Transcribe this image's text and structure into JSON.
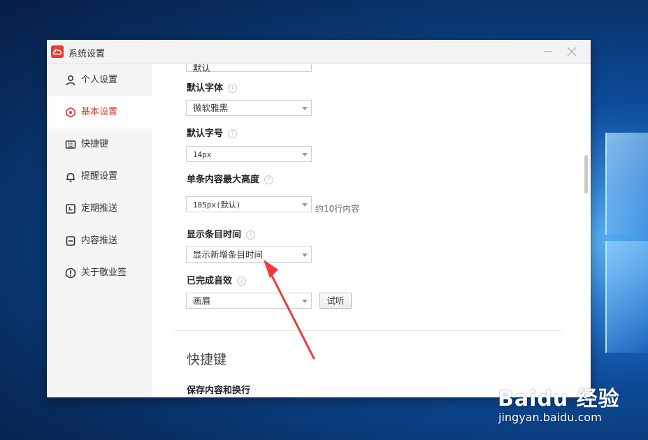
{
  "window": {
    "title": "系统设置"
  },
  "sidebar": {
    "items": [
      {
        "label": "个人设置",
        "icon": "user-icon"
      },
      {
        "label": "基本设置",
        "icon": "settings-hex-icon",
        "active": true
      },
      {
        "label": "快捷键",
        "icon": "keyboard-icon"
      },
      {
        "label": "提醒设置",
        "icon": "bell-icon"
      },
      {
        "label": "定期推送",
        "icon": "clock-icon"
      },
      {
        "label": "内容推送",
        "icon": "doc-icon"
      },
      {
        "label": "关于敬业签",
        "icon": "info-icon"
      }
    ]
  },
  "content": {
    "partial_value": "默认",
    "default_font": {
      "label": "默认字体",
      "value": "微软雅黑"
    },
    "default_size": {
      "label": "默认字号",
      "value": "14px"
    },
    "max_height": {
      "label": "单条内容最大高度",
      "value": "185px(默认)",
      "hint": "约10行内容"
    },
    "show_time": {
      "label": "显示条目时间",
      "value": "显示新增条目时间"
    },
    "done_sound": {
      "label": "已完成音效",
      "value": "画眉",
      "button": "试听"
    },
    "section_title": "快捷键",
    "sub_label": "保存内容和换行"
  },
  "colors": {
    "accent": "#d93b32",
    "app_logo": "#e83a3a",
    "arrow": "#ec3a3a"
  },
  "watermark": {
    "logo": "Baidu 经验",
    "url": "jingyan.baidu.com"
  }
}
